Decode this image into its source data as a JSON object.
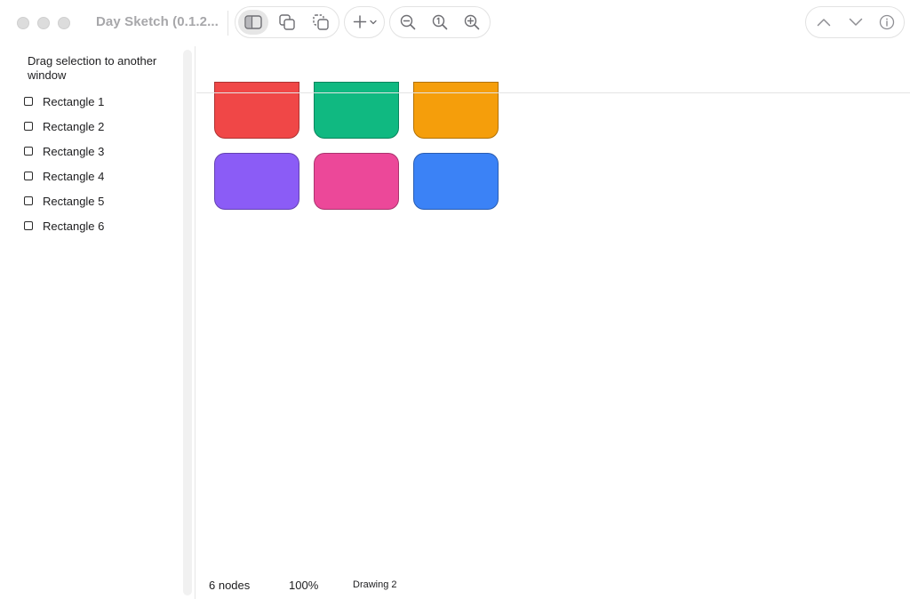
{
  "window": {
    "title": "Day Sketch (0.1.2..."
  },
  "toolbar": {
    "view_group": [
      {
        "icon": "sidebar-icon",
        "active": true
      },
      {
        "icon": "duplicate-icon",
        "active": false
      },
      {
        "icon": "copy-icon",
        "active": false
      }
    ],
    "add": {
      "icon": "plus-icon",
      "dropdown_icon": "chevron-down-icon"
    },
    "zoom_group": [
      {
        "icon": "zoom-out-icon"
      },
      {
        "icon": "zoom-actual-icon"
      },
      {
        "icon": "zoom-in-icon"
      }
    ],
    "nav_group": [
      {
        "icon": "chevron-up-icon"
      },
      {
        "icon": "chevron-down-icon"
      },
      {
        "icon": "info-icon"
      }
    ]
  },
  "sidebar": {
    "hint": "Drag selection to another window",
    "items": [
      {
        "label": "Rectangle 1"
      },
      {
        "label": "Rectangle 2"
      },
      {
        "label": "Rectangle 3"
      },
      {
        "label": "Rectangle 4"
      },
      {
        "label": "Rectangle 5"
      },
      {
        "label": "Rectangle 6"
      }
    ]
  },
  "canvas": {
    "shapes": [
      {
        "name": "Rectangle 1",
        "color": "#f04747"
      },
      {
        "name": "Rectangle 2",
        "color": "#10b981"
      },
      {
        "name": "Rectangle 3",
        "color": "#f59e0b"
      },
      {
        "name": "Rectangle 4",
        "color": "#8b5cf6"
      },
      {
        "name": "Rectangle 5",
        "color": "#ec4899"
      },
      {
        "name": "Rectangle 6",
        "color": "#3b82f6"
      }
    ]
  },
  "status": {
    "nodes": "6 nodes",
    "zoom": "100%",
    "document": "Drawing 2"
  }
}
